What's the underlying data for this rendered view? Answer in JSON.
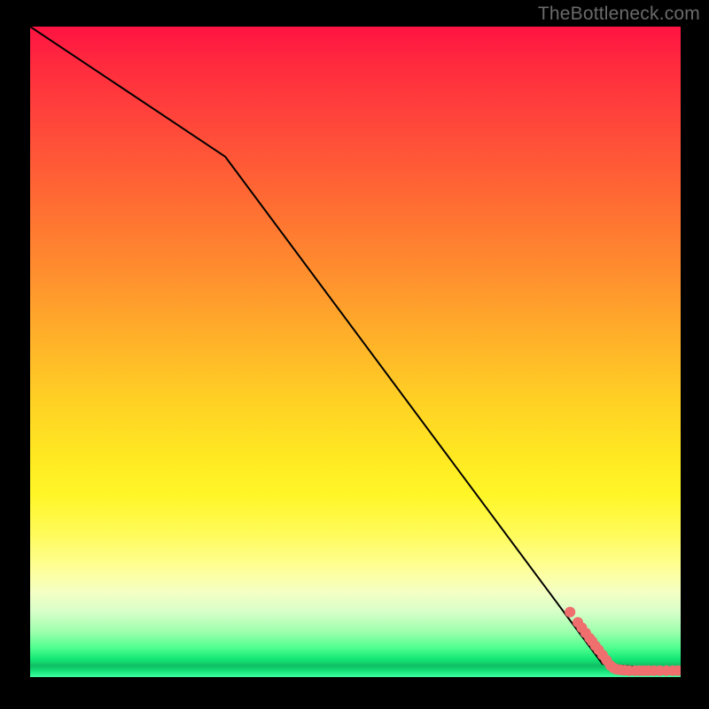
{
  "watermark": "TheBottleneck.com",
  "chart_data": {
    "type": "line",
    "title": "",
    "xlabel": "",
    "ylabel": "",
    "xlim": [
      0,
      100
    ],
    "ylim": [
      0,
      100
    ],
    "grid": false,
    "legend": false,
    "series": [
      {
        "name": "curve",
        "x": [
          0,
          30,
          88,
          100
        ],
        "y": [
          100,
          80,
          2,
          1
        ],
        "stroke": "#000000",
        "stroke_width": 2
      }
    ],
    "scatter": {
      "name": "points",
      "color": "#ef6e6e",
      "radius": 6,
      "points": [
        {
          "x": 83.0,
          "y": 10.0
        },
        {
          "x": 84.2,
          "y": 8.4
        },
        {
          "x": 84.8,
          "y": 7.6
        },
        {
          "x": 85.4,
          "y": 6.8
        },
        {
          "x": 86.0,
          "y": 6.0
        },
        {
          "x": 86.4,
          "y": 5.5
        },
        {
          "x": 86.9,
          "y": 4.8
        },
        {
          "x": 87.4,
          "y": 4.2
        },
        {
          "x": 88.0,
          "y": 3.4
        },
        {
          "x": 88.6,
          "y": 2.6
        },
        {
          "x": 89.2,
          "y": 1.8
        },
        {
          "x": 89.7,
          "y": 1.4
        },
        {
          "x": 90.2,
          "y": 1.2
        },
        {
          "x": 90.8,
          "y": 1.1
        },
        {
          "x": 91.4,
          "y": 1.05
        },
        {
          "x": 92.1,
          "y": 1.0
        },
        {
          "x": 93.0,
          "y": 1.0
        },
        {
          "x": 93.7,
          "y": 1.0
        },
        {
          "x": 94.4,
          "y": 1.0
        },
        {
          "x": 95.1,
          "y": 1.0
        },
        {
          "x": 95.9,
          "y": 1.0
        },
        {
          "x": 96.8,
          "y": 1.0
        },
        {
          "x": 97.8,
          "y": 1.0
        },
        {
          "x": 98.8,
          "y": 1.0
        },
        {
          "x": 99.6,
          "y": 1.0
        }
      ]
    },
    "gradient_stops": [
      {
        "pos": 0.0,
        "color": "#ff1342"
      },
      {
        "pos": 0.5,
        "color": "#ffb827"
      },
      {
        "pos": 0.78,
        "color": "#fffb5a"
      },
      {
        "pos": 0.92,
        "color": "#9effae"
      },
      {
        "pos": 0.97,
        "color": "#15e876"
      },
      {
        "pos": 1.0,
        "color": "#3fffa0"
      }
    ]
  }
}
